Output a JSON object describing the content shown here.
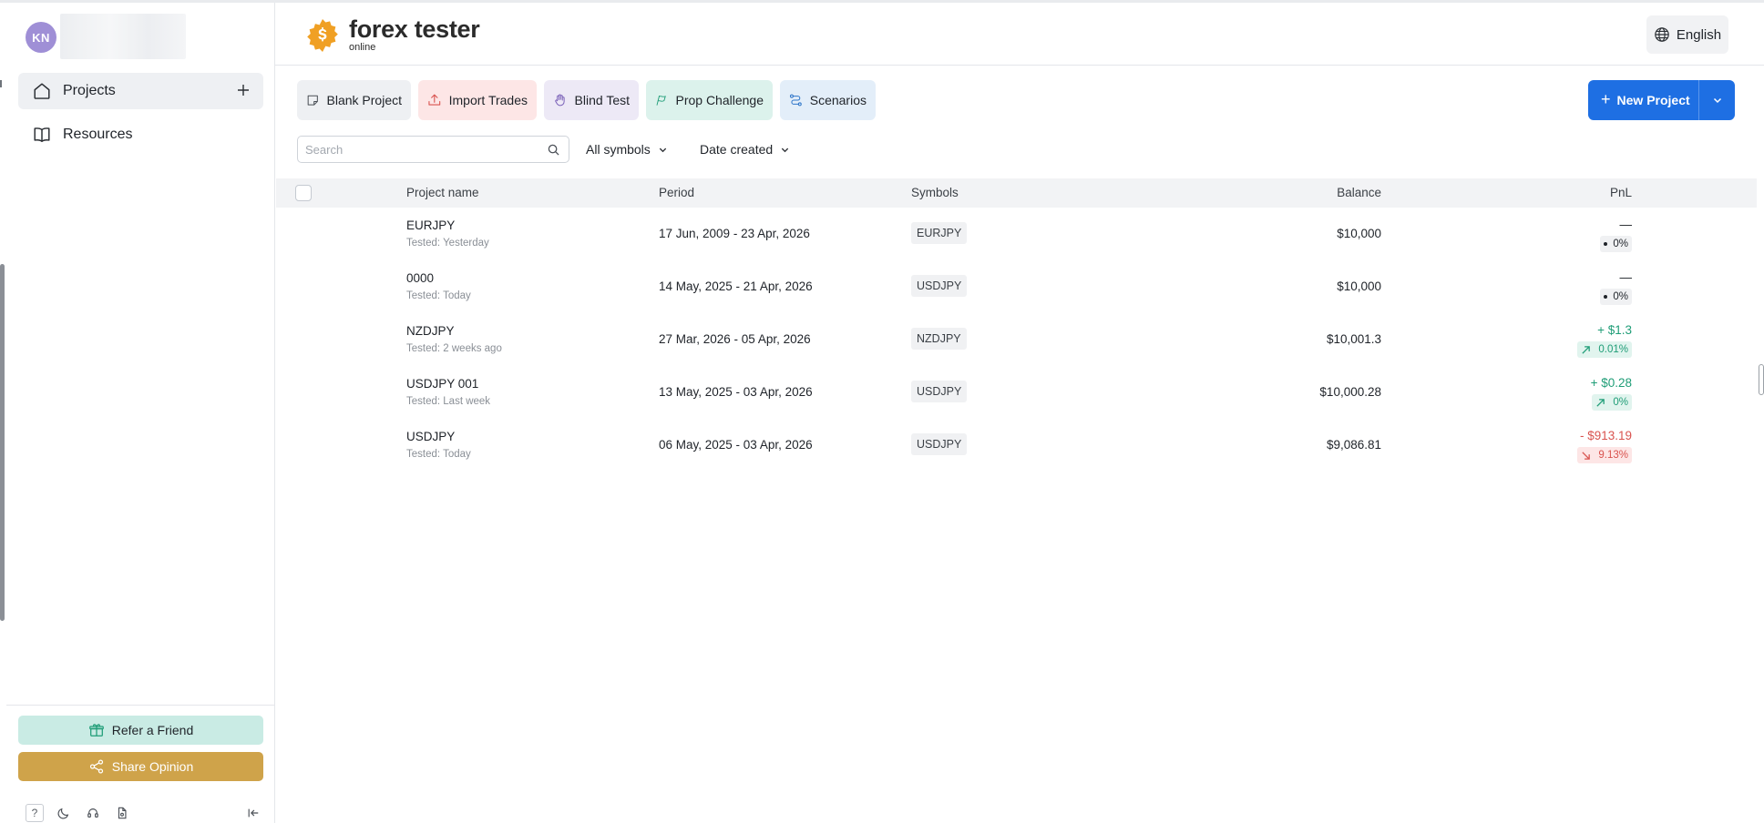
{
  "user": {
    "initials": "KN"
  },
  "sidebar": {
    "items": [
      {
        "label": "Projects"
      },
      {
        "label": "Resources"
      }
    ],
    "refer_label": "Refer a Friend",
    "share_label": "Share Opinion",
    "help_label": "?"
  },
  "brand": {
    "name": "forex tester",
    "sub": "online"
  },
  "header": {
    "language": "English"
  },
  "toolbar": {
    "blank": "Blank Project",
    "import": "Import Trades",
    "blind": "Blind Test",
    "prop": "Prop Challenge",
    "scenarios": "Scenarios",
    "new_project": "New Project"
  },
  "filters": {
    "search_placeholder": "Search",
    "symbols": "All symbols",
    "sort": "Date created"
  },
  "table": {
    "columns": [
      "Project name",
      "Period",
      "Symbols",
      "Balance",
      "PnL"
    ],
    "rows": [
      {
        "name": "EURJPY",
        "tested": "Tested: Yesterday",
        "period": "17 Jun, 2009 - 23 Apr, 2026",
        "symbol": "EURJPY",
        "balance": "$10,000",
        "pnl": "—",
        "pnl_pct": "0%",
        "trend": "neutral"
      },
      {
        "name": "0000",
        "tested": "Tested: Today",
        "period": "14 May, 2025 - 21 Apr, 2026",
        "symbol": "USDJPY",
        "balance": "$10,000",
        "pnl": "—",
        "pnl_pct": "0%",
        "trend": "neutral"
      },
      {
        "name": "NZDJPY",
        "tested": "Tested: 2 weeks ago",
        "period": "27 Mar, 2026 - 05 Apr, 2026",
        "symbol": "NZDJPY",
        "balance": "$10,001.3",
        "pnl": "+ $1.3",
        "pnl_pct": "0.01%",
        "trend": "up"
      },
      {
        "name": "USDJPY 001",
        "tested": "Tested: Last week",
        "period": "13 May, 2025 - 03 Apr, 2026",
        "symbol": "USDJPY",
        "balance": "$10,000.28",
        "pnl": "+ $0.28",
        "pnl_pct": "0%",
        "trend": "up"
      },
      {
        "name": "USDJPY",
        "tested": "Tested: Today",
        "period": "06 May, 2025 - 03 Apr, 2026",
        "symbol": "USDJPY",
        "balance": "$9,086.81",
        "pnl": "- $913.19",
        "pnl_pct": "9.13%",
        "trend": "down"
      }
    ]
  },
  "colors": {
    "accent": "#1e6fe3",
    "positive": "#1f9d77",
    "negative": "#d9534f",
    "share": "#cfa34a",
    "refer": "#c9ebe4"
  }
}
